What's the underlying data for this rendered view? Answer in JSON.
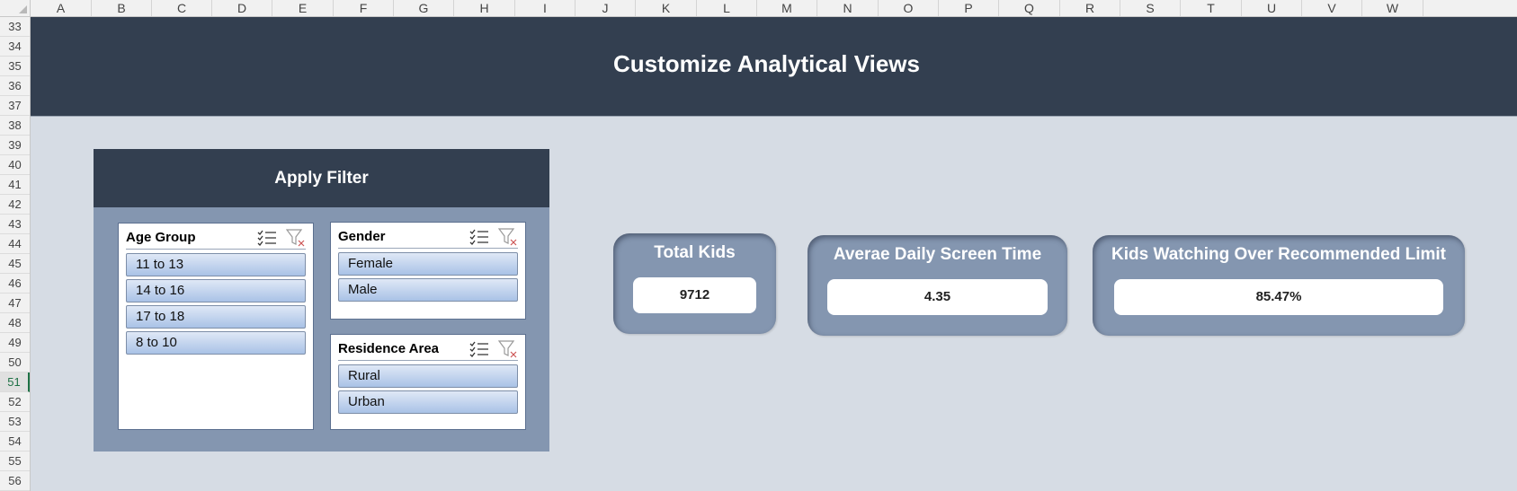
{
  "columns": [
    "A",
    "B",
    "C",
    "D",
    "E",
    "F",
    "G",
    "H",
    "I",
    "J",
    "K",
    "L",
    "M",
    "N",
    "O",
    "P",
    "Q",
    "R",
    "S",
    "T",
    "U",
    "V",
    "W"
  ],
  "rows": [
    "33",
    "34",
    "35",
    "36",
    "37",
    "38",
    "39",
    "40",
    "41",
    "42",
    "43",
    "44",
    "45",
    "46",
    "47",
    "48",
    "49",
    "50",
    "51",
    "52",
    "53",
    "54",
    "55",
    "56"
  ],
  "active_row": "51",
  "banner": {
    "title": "Customize Analytical Views"
  },
  "filter_panel": {
    "title": "Apply Filter",
    "slicers": [
      {
        "title": "Age Group",
        "items": [
          "11 to 13",
          "14 to 16",
          "17 to 18",
          "8 to 10"
        ]
      },
      {
        "title": "Gender",
        "items": [
          "Female",
          "Male"
        ]
      },
      {
        "title": "Residence Area",
        "items": [
          "Rural",
          "Urban"
        ]
      }
    ],
    "icons": [
      "multi-select-icon",
      "clear-filter-icon"
    ]
  },
  "kpis": [
    {
      "title": "Total Kids",
      "value": "9712"
    },
    {
      "title": "Averae Daily Screen Time",
      "value": "4.35"
    },
    {
      "title": "Kids Watching Over Recommended Limit",
      "value": "85.47%"
    }
  ],
  "colors": {
    "banner": "#333f50",
    "sheet_bg": "#d6dce4",
    "panel": "#8496b0",
    "slicer_button": "#a9c2e6"
  }
}
